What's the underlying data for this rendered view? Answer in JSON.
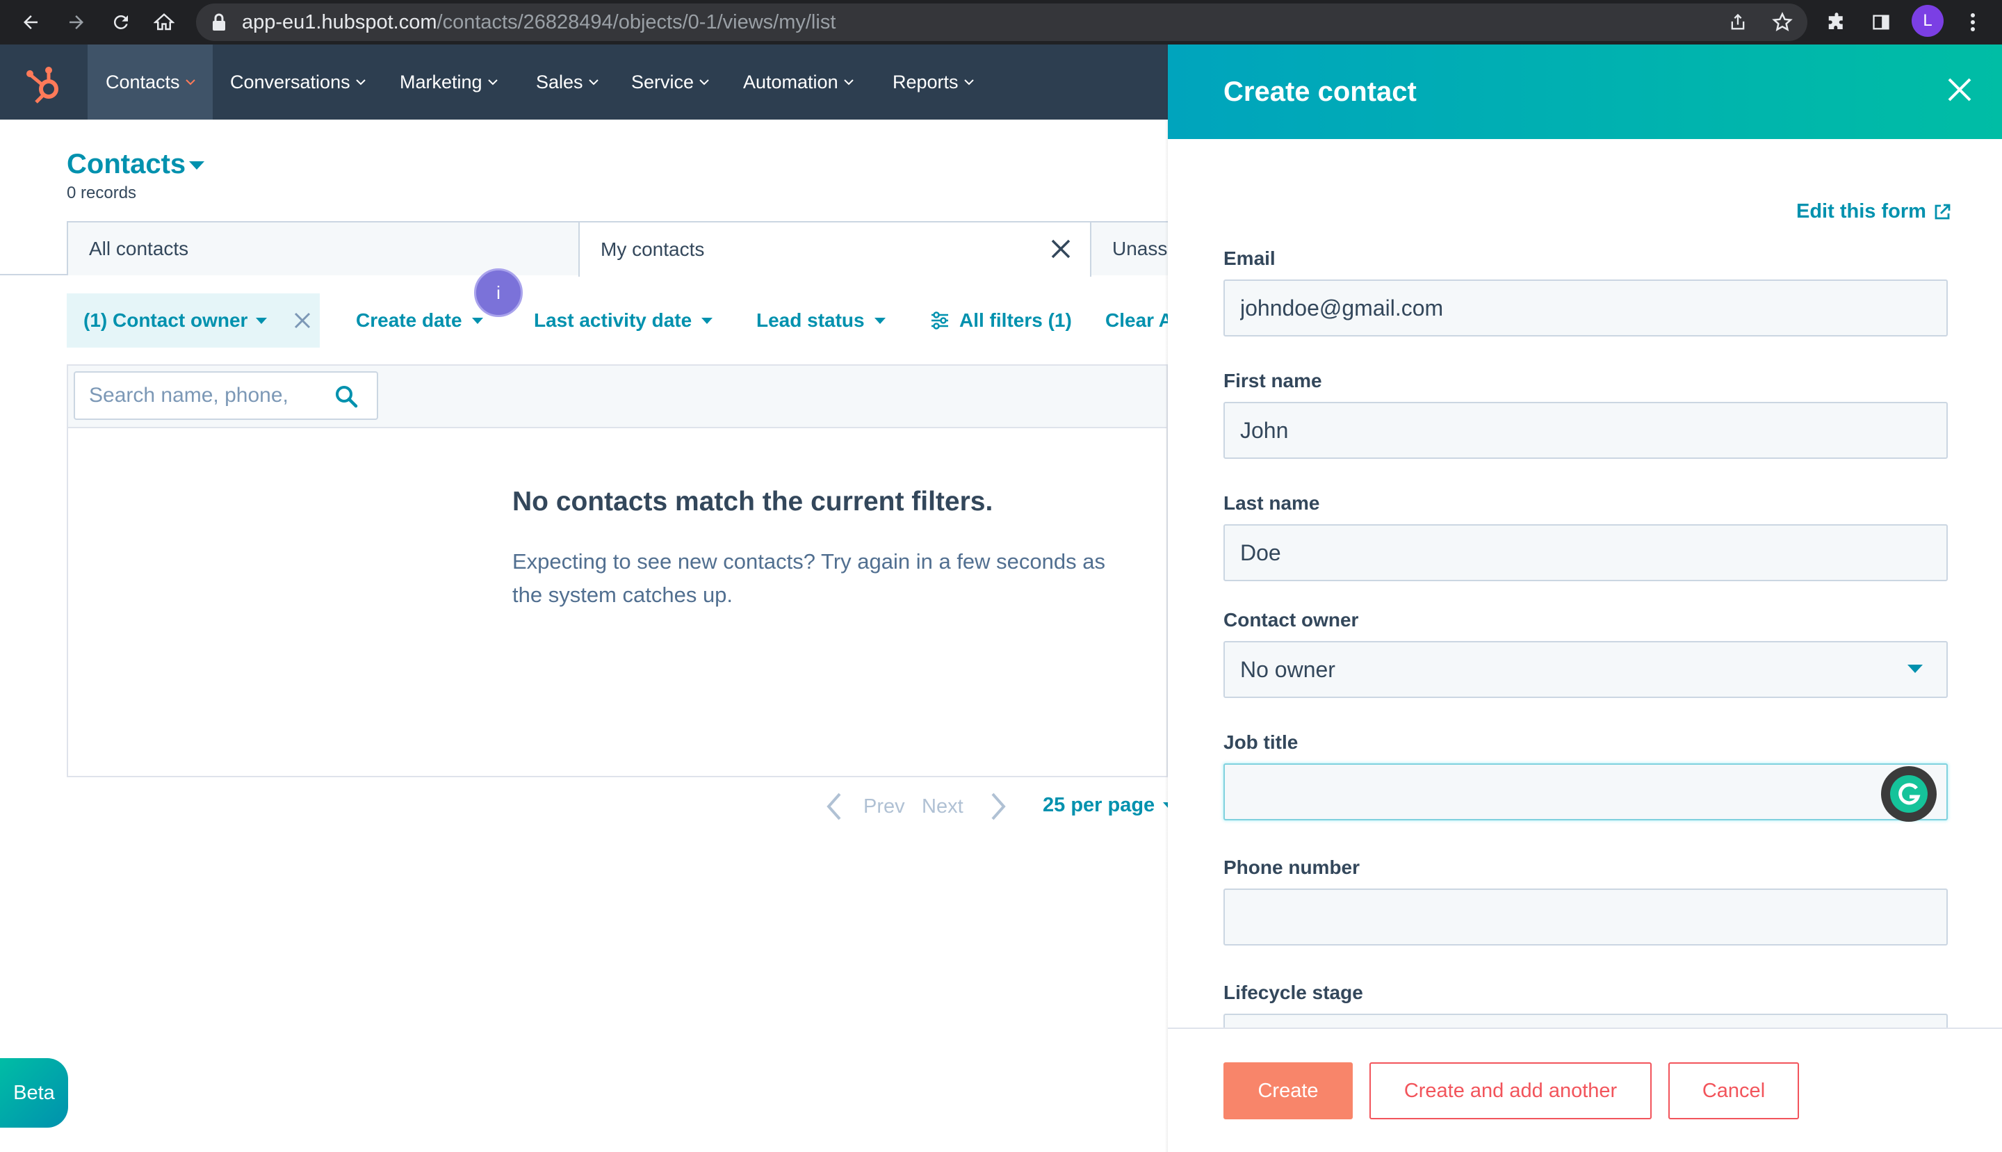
{
  "browser": {
    "url_host": "app-eu1.hubspot.com",
    "url_path": "/contacts/26828494/objects/0-1/views/my/list",
    "profile_initial": "L"
  },
  "nav": {
    "items": [
      {
        "label": "Contacts"
      },
      {
        "label": "Conversations"
      },
      {
        "label": "Marketing"
      },
      {
        "label": "Sales"
      },
      {
        "label": "Service"
      },
      {
        "label": "Automation"
      },
      {
        "label": "Reports"
      }
    ]
  },
  "page": {
    "title": "Contacts",
    "record_count": "0 records"
  },
  "view_tabs": {
    "all": "All contacts",
    "my": "My contacts",
    "unassigned": "Unassi"
  },
  "filters": {
    "contact_owner": "(1) Contact owner",
    "create_date": "Create date",
    "last_activity": "Last activity date",
    "lead_status": "Lead status",
    "all_filters": "All filters (1)",
    "clear_all": "Clear A",
    "info_badge": "i"
  },
  "search": {
    "placeholder": "Search name, phone, "
  },
  "empty_state": {
    "title": "No contacts match the current filters.",
    "description": "Expecting to see new contacts? Try again in a few seconds as the system catches up."
  },
  "pagination": {
    "prev": "Prev",
    "next": "Next",
    "per_page": "25 per page"
  },
  "beta_label": "Beta",
  "panel": {
    "title": "Create contact",
    "edit_form_link": "Edit this form",
    "fields": {
      "email": {
        "label": "Email",
        "value": "johndoe@gmail.com"
      },
      "first_name": {
        "label": "First name",
        "value": "John"
      },
      "last_name": {
        "label": "Last name",
        "value": "Doe"
      },
      "contact_owner": {
        "label": "Contact owner",
        "value": "No owner"
      },
      "job_title": {
        "label": "Job title",
        "value": ""
      },
      "phone": {
        "label": "Phone number",
        "value": ""
      },
      "lifecycle": {
        "label": "Lifecycle stage"
      }
    },
    "buttons": {
      "create": "Create",
      "create_another": "Create and add another",
      "cancel": "Cancel"
    }
  },
  "colors": {
    "brand_teal": "#0091ae",
    "nav_bg": "#2d3e50",
    "cta_orange": "#f8856a",
    "secondary_red": "#f2545b"
  }
}
